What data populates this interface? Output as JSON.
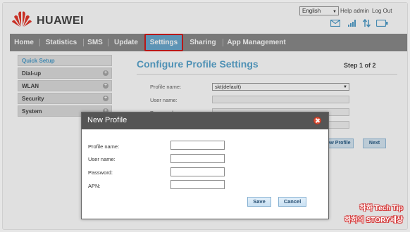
{
  "header": {
    "brand": "HUAWEI",
    "language": "English",
    "links": [
      "Help",
      "admin",
      "Log Out"
    ],
    "status_icons": [
      "mail-icon",
      "signal-icon",
      "data-transfer-icon",
      "battery-icon"
    ],
    "brand_color": "#e4372b"
  },
  "nav": {
    "items": [
      "Home",
      "Statistics",
      "SMS",
      "Update",
      "Settings",
      "Sharing",
      "App Management"
    ],
    "active": "Settings",
    "highlight_color": "#d21c1c"
  },
  "sidebar": {
    "items": [
      "Quick Setup",
      "Dial-up",
      "WLAN",
      "Security",
      "System"
    ],
    "current": "Quick Setup"
  },
  "main": {
    "title": "Configure Profile Settings",
    "step": "Step 1 of 2",
    "fields": {
      "profile_name_label": "Profile name:",
      "profile_name_value": "skt(default)",
      "user_name_label": "User name:",
      "password_label": "Password:"
    },
    "new_profile_button": "New Profile",
    "next_button": "Next"
  },
  "dialog": {
    "title": "New Profile",
    "fields": [
      "Profile name:",
      "User name:",
      "Password:",
      "APN:"
    ],
    "save_button": "Save",
    "cancel_button": "Cancel"
  },
  "watermark": {
    "line1": "하하 Tech Tip",
    "line2": "하하의 STORY세상"
  }
}
